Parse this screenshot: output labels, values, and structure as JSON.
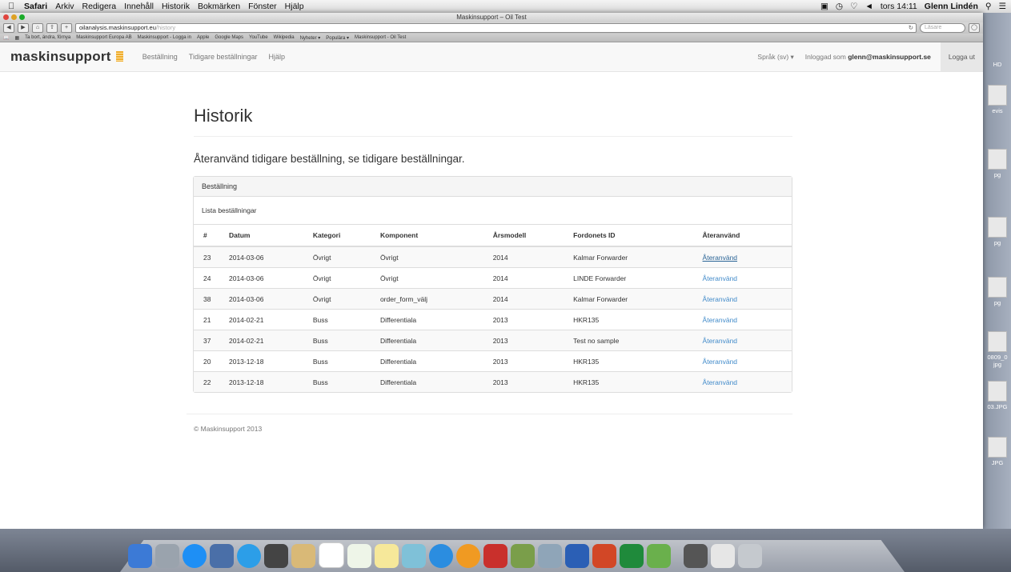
{
  "menubar": {
    "app": "Safari",
    "items": [
      "Arkiv",
      "Redigera",
      "Innehåll",
      "Historik",
      "Bokmärken",
      "Fönster",
      "Hjälp"
    ],
    "clock": "tors 14:11",
    "user": "Glenn Lindén"
  },
  "browser": {
    "window_title": "Maskinsupport – Oil Test",
    "url_host": "oilanalysis.maskinsupport.eu",
    "url_path": "/history",
    "search_placeholder": "Läsare",
    "bookmarks": [
      "Ta bort, ändra, förnya",
      "Maskinsupport Europa AB",
      "Maskinsupport - Logga in",
      "Apple",
      "Google Maps",
      "YouTube",
      "Wikipedia",
      "Nyheter ▾",
      "Populära ▾",
      "Maskinsupport - Oil Test"
    ]
  },
  "navbar": {
    "brand": "maskinsupport",
    "links": [
      "Beställning",
      "Tidigare beställningar",
      "Hjälp"
    ],
    "language": "Språk (sv) ▾",
    "logged_in_prefix": "Inloggad som",
    "logged_in_user": "glenn@maskinsupport.se",
    "logout": "Logga ut"
  },
  "page": {
    "title": "Historik",
    "lead": "Återanvänd tidigare beställning, se tidigare beställningar.",
    "panel_heading": "Beställning",
    "panel_body": "Lista beställningar"
  },
  "table": {
    "headers": [
      "#",
      "Datum",
      "Kategori",
      "Komponent",
      "Årsmodell",
      "Fordonets ID",
      "Återanvänd"
    ],
    "rows": [
      {
        "id": "23",
        "date": "2014-03-06",
        "category": "Övrigt",
        "component": "Övrigt",
        "year": "2014",
        "vehicle": "Kalmar Forwarder",
        "action": "Återanvänd"
      },
      {
        "id": "24",
        "date": "2014-03-06",
        "category": "Övrigt",
        "component": "Övrigt",
        "year": "2014",
        "vehicle": "LINDE Forwarder",
        "action": "Återanvänd"
      },
      {
        "id": "38",
        "date": "2014-03-06",
        "category": "Övrigt",
        "component": "order_form_välj",
        "year": "2014",
        "vehicle": "Kalmar Forwarder",
        "action": "Återanvänd"
      },
      {
        "id": "21",
        "date": "2014-02-21",
        "category": "Buss",
        "component": "Differentiala",
        "year": "2013",
        "vehicle": "HKR135",
        "action": "Återanvänd"
      },
      {
        "id": "37",
        "date": "2014-02-21",
        "category": "Buss",
        "component": "Differentiala",
        "year": "2013",
        "vehicle": "Test no sample",
        "action": "Återanvänd"
      },
      {
        "id": "20",
        "date": "2013-12-18",
        "category": "Buss",
        "component": "Differentiala",
        "year": "2013",
        "vehicle": "HKR135",
        "action": "Återanvänd"
      },
      {
        "id": "22",
        "date": "2013-12-18",
        "category": "Buss",
        "component": "Differentiala",
        "year": "2013",
        "vehicle": "HKR135",
        "action": "Återanvänd"
      }
    ]
  },
  "footer": "© Maskinsupport 2013",
  "desktop_labels": [
    "HD",
    "evis",
    "pg",
    "pg",
    "pg",
    "0809_0",
    "jpg",
    "03.JPG",
    "JPG"
  ],
  "colors": {
    "link": "#428bca",
    "brand_mark": "#f0ad2e"
  }
}
